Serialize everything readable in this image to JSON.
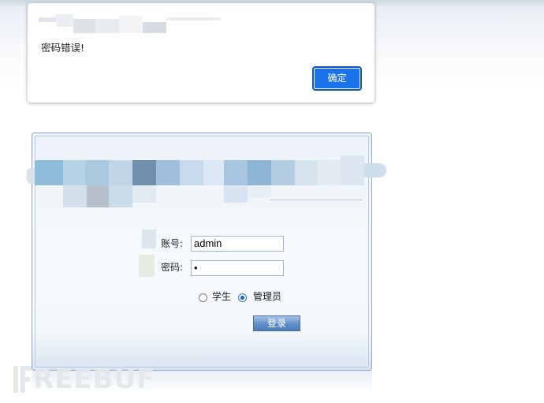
{
  "alert": {
    "message": "密码错误!",
    "ok_label": "确定"
  },
  "login": {
    "account_label": "账号:",
    "account_value": "admin",
    "password_label": "密码:",
    "password_value": "•",
    "role_options": [
      {
        "label": "学生",
        "checked": false
      },
      {
        "label": "管理员",
        "checked": true
      }
    ],
    "submit_label": "登录"
  },
  "watermark": {
    "text": "FREEBUF"
  },
  "colors": {
    "ok_button": "#1a73e8",
    "panel_border": "#8fa7c2",
    "login_button": "#5f8ec9"
  }
}
